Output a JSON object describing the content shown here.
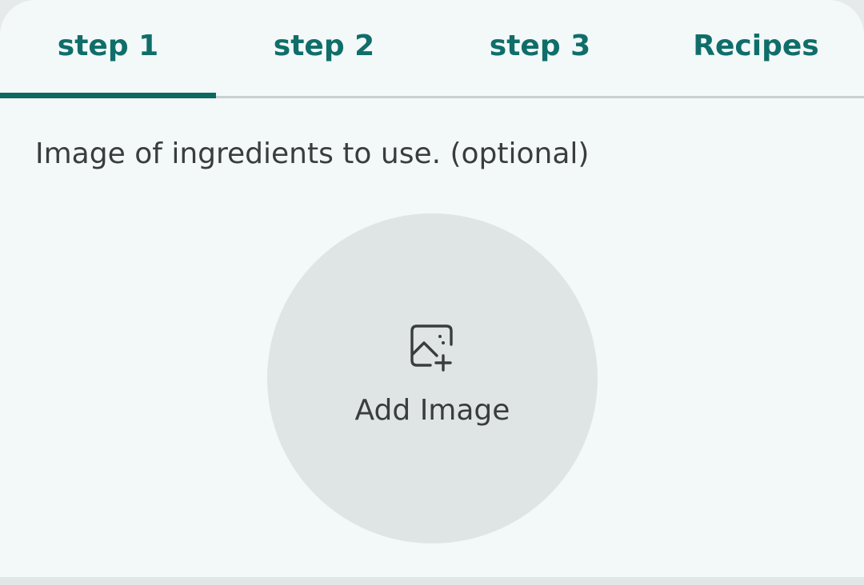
{
  "tabs": [
    {
      "label": "step 1",
      "selected": true
    },
    {
      "label": "step 2",
      "selected": false
    },
    {
      "label": "step 3",
      "selected": false
    },
    {
      "label": "Recipes",
      "selected": false
    }
  ],
  "content": {
    "prompt": "Image of ingredients to use. (optional)",
    "add_image": {
      "label": "Add Image",
      "icon": "add-photo-icon"
    }
  },
  "colors": {
    "accent": "#0d6763",
    "tab_text": "#0f6e6a",
    "background": "#f3f8f8",
    "circle": "#dfe4e4",
    "text": "#3a3d3d"
  }
}
